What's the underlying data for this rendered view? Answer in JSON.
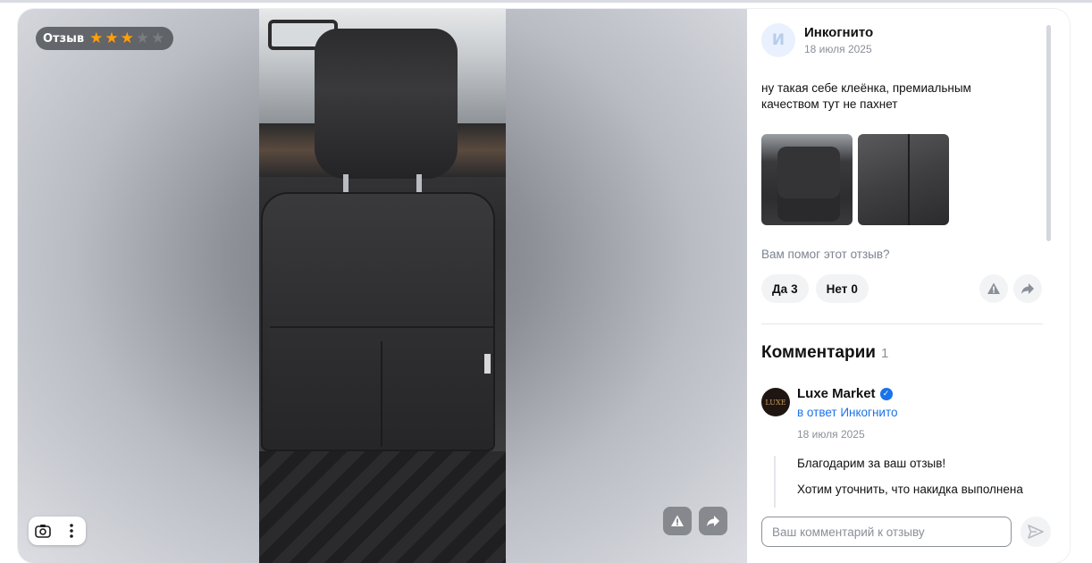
{
  "review_badge": {
    "label": "Отзыв",
    "rating": 3,
    "max_rating": 5
  },
  "colors": {
    "star_on": "#ff9f0a",
    "star_off": "#7a7c80",
    "link": "#1a73e8",
    "verified": "#1a73e8"
  },
  "media": {
    "camera_icon": "camera-icon",
    "more_icon": "more-vertical-icon",
    "report_icon": "warning-icon",
    "share_icon": "share-icon"
  },
  "review": {
    "author_initial": "И",
    "author_name": "Инкогнито",
    "date": "18 июля 2025",
    "text": "ну такая себе клеёнка, премиальным качеством тут не пахнет",
    "photos": [
      "photo-seat-back",
      "photo-seat-pocket"
    ]
  },
  "helpful": {
    "question": "Вам помог этот отзыв?",
    "yes_label": "Да",
    "yes_count": "3",
    "no_label": "Нет",
    "no_count": "0"
  },
  "comments": {
    "title": "Комментарии",
    "count": "1",
    "items": [
      {
        "avatar_text": "LUXE",
        "name": "Luxe Market",
        "reply_to": "в ответ Инкогнито",
        "date": "18 июля 2025",
        "lines": [
          "Благодарим за ваш отзыв!",
          "Хотим уточнить, что накидка выполнена"
        ]
      }
    ],
    "input_placeholder": "Ваш комментарий к отзыву"
  }
}
